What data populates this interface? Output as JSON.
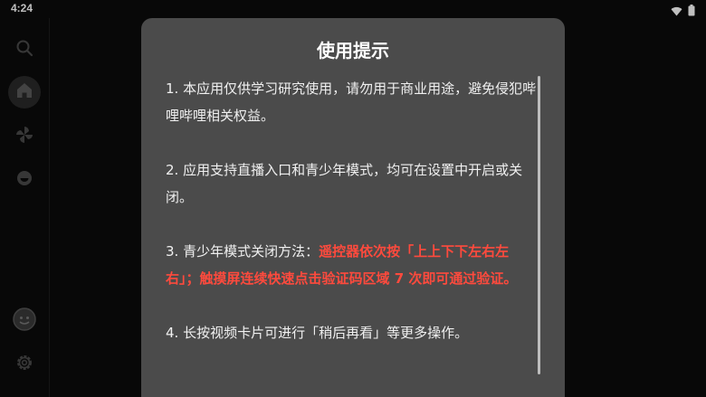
{
  "status_bar": {
    "time": "4:24",
    "icons": [
      "wifi-icon",
      "battery-icon"
    ]
  },
  "sidebar": {
    "items": [
      {
        "name": "search-icon",
        "active": false
      },
      {
        "name": "home-icon",
        "active": true
      },
      {
        "name": "pinwheel-icon",
        "active": false
      },
      {
        "name": "bilibili-icon",
        "active": false
      }
    ],
    "bottom": [
      {
        "name": "avatar"
      },
      {
        "name": "gear-icon"
      }
    ]
  },
  "dialog": {
    "title": "使用提示",
    "paragraphs": [
      {
        "prefix": "1. 本应用仅供学习研究使用，请勿用于商业用途，避免侵犯哔哩哔哩相关权益。",
        "highlight": ""
      },
      {
        "prefix": "2. 应用支持直播入口和青少年模式，均可在设置中开启或关闭。",
        "highlight": ""
      },
      {
        "prefix": "3. 青少年模式关闭方法：",
        "highlight": "遥控器依次按「上上下下左右左右」；触摸屏连续快速点击验证码区域 7 次即可通过验证。"
      },
      {
        "prefix": "4. 长按视频卡片可进行「稍后再看」等更多操作。",
        "highlight": ""
      }
    ]
  },
  "colors": {
    "dialog_bg": "#4b4b4b",
    "highlight": "#ff4a3d",
    "background": "#0b0b0b"
  }
}
